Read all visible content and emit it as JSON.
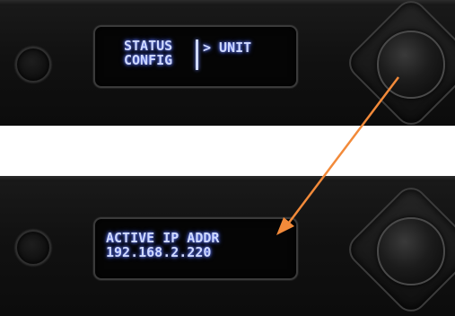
{
  "top_display": {
    "menu_left": [
      "STATUS",
      "CONFIG"
    ],
    "menu_right": "> UNIT"
  },
  "bottom_display": {
    "line1": "ACTIVE IP ADDR",
    "line2": "192.168.2.220"
  },
  "annotation": {
    "arrow_color": "#f28a3a"
  },
  "colors": {
    "oled_text": "#cfd9ff",
    "panel": "#111111"
  }
}
